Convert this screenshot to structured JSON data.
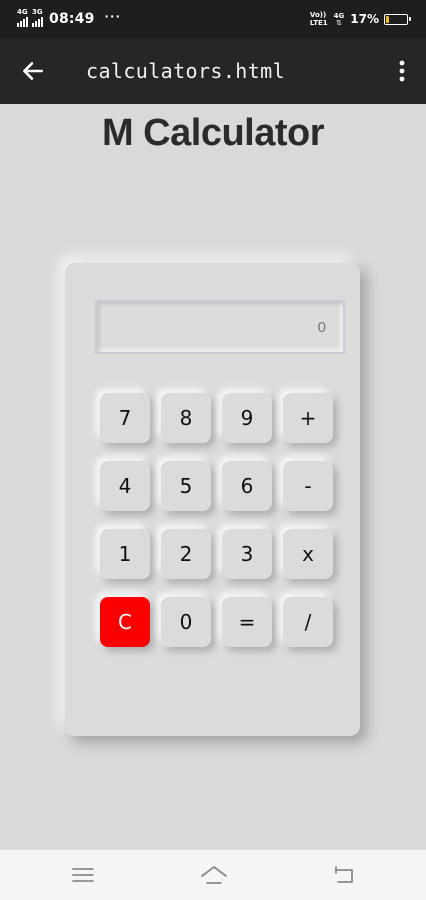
{
  "status_bar": {
    "network1": "4G",
    "network2": "3G",
    "time": "08:49",
    "more": "···",
    "volte_line1": "Vo))",
    "volte_line2": "LTE1",
    "network3": "4G",
    "battery_percent_text": "17%",
    "battery_level": 0.17,
    "battery_color": "#f2c21b"
  },
  "toolbar": {
    "back_icon": "arrow-left-icon",
    "title": "calculators.html",
    "menu_icon": "more-vertical-icon"
  },
  "page": {
    "title": "M Calculator"
  },
  "calculator": {
    "display_value": "0",
    "keys": [
      [
        "7",
        "8",
        "9",
        "+"
      ],
      [
        "4",
        "5",
        "6",
        "-"
      ],
      [
        "1",
        "2",
        "3",
        "x"
      ],
      [
        "C",
        "0",
        "=",
        "/"
      ]
    ],
    "clear_color": "#fb0000"
  },
  "nav_bar": {
    "menu_icon": "hamburger-icon",
    "home_icon": "home-icon",
    "back_icon": "return-icon"
  }
}
